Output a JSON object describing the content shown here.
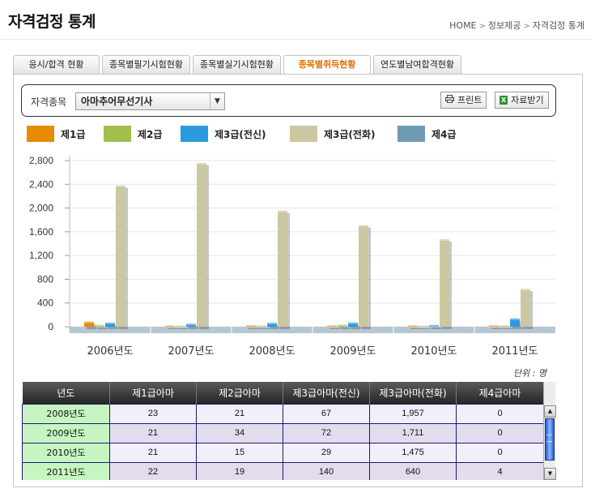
{
  "header": {
    "title": "자격검정 통계",
    "breadcrumb": [
      "HOME",
      "정보제공",
      "자격검정 통계"
    ],
    "breadcrumb_sep": ">"
  },
  "tabs": [
    {
      "label": "응시/합격 현황",
      "active": false
    },
    {
      "label": "종목별필기시험현황",
      "active": false
    },
    {
      "label": "종목별실기시험현황",
      "active": false
    },
    {
      "label": "종목별취득현황",
      "active": true
    },
    {
      "label": "연도별남여합격현황",
      "active": false
    }
  ],
  "filter": {
    "label": "자격종목",
    "selected": "아마추어무선기사",
    "dropdown_arrow": "▼",
    "print_label": "프린트",
    "print_icon": "printer-icon",
    "download_label": "자료받기",
    "download_icon": "excel-icon",
    "download_icon_text": "X"
  },
  "legend": [
    {
      "label": "제1급",
      "color": "#e88a00"
    },
    {
      "label": "제2급",
      "color": "#a1c04b"
    },
    {
      "label": "제3급(전신)",
      "color": "#2a9be0"
    },
    {
      "label": "제3급(전화)",
      "color": "#cbc7a0"
    },
    {
      "label": "제4급",
      "color": "#6e9bb1"
    }
  ],
  "chart_data": {
    "type": "bar",
    "categories": [
      "2006년도",
      "2007년도",
      "2008년도",
      "2009년도",
      "2010년도",
      "2011년도"
    ],
    "series": [
      {
        "name": "제1급",
        "values": [
          85,
          20,
          23,
          21,
          21,
          22
        ]
      },
      {
        "name": "제2급",
        "values": [
          30,
          18,
          21,
          34,
          15,
          19
        ]
      },
      {
        "name": "제3급(전신)",
        "values": [
          70,
          50,
          67,
          72,
          29,
          140
        ]
      },
      {
        "name": "제3급(전화)",
        "values": [
          2380,
          2760,
          1957,
          1711,
          1475,
          640
        ]
      },
      {
        "name": "제4급",
        "values": [
          0,
          0,
          0,
          0,
          0,
          4
        ]
      }
    ],
    "y_ticks": [
      "0",
      "400",
      "800",
      "1,200",
      "1,600",
      "2,000",
      "2,400",
      "2,800"
    ],
    "ylim": [
      0,
      2800
    ],
    "grid": true
  },
  "unit_label": "단위 : 명",
  "table": {
    "columns": [
      "년도",
      "제1급아마",
      "제2급아마",
      "제3급아마(전신)",
      "제3급아마(전화)",
      "제4급아마"
    ],
    "rows": [
      [
        "2008년도",
        "23",
        "21",
        "67",
        "1,957",
        "0"
      ],
      [
        "2009년도",
        "21",
        "34",
        "72",
        "1,711",
        "0"
      ],
      [
        "2010년도",
        "21",
        "15",
        "29",
        "1,475",
        "0"
      ],
      [
        "2011년도",
        "22",
        "19",
        "140",
        "640",
        "4"
      ]
    ],
    "scroll_up": "▲",
    "scroll_down": "▼"
  }
}
